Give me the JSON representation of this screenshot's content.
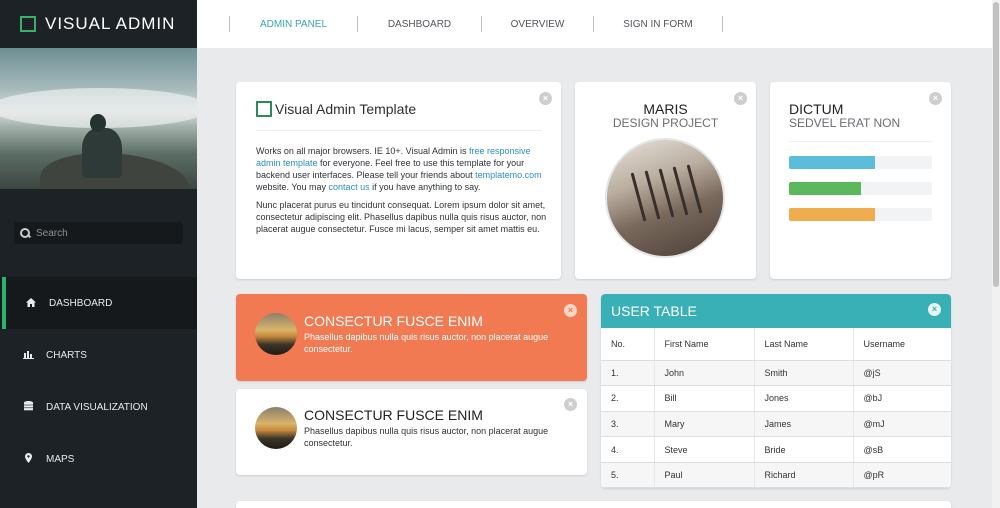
{
  "brand": {
    "title": "VISUAL ADMIN"
  },
  "search": {
    "placeholder": "Search"
  },
  "sidebar": {
    "items": [
      {
        "label": "DASHBOARD",
        "icon": "home-icon",
        "active": true
      },
      {
        "label": "CHARTS",
        "icon": "bar-chart-icon"
      },
      {
        "label": "DATA VISUALIZATION",
        "icon": "database-icon"
      },
      {
        "label": "MAPS",
        "icon": "map-marker-icon"
      }
    ]
  },
  "topnav": {
    "items": [
      {
        "label": "ADMIN PANEL",
        "active": true
      },
      {
        "label": "DASHBOARD"
      },
      {
        "label": "OVERVIEW"
      },
      {
        "label": "SIGN IN FORM"
      }
    ]
  },
  "intro": {
    "title": "Visual Admin Template",
    "p1_a": "Works on all major browsers. IE 10+. Visual Admin is ",
    "p1_link1": "free responsive admin template",
    "p1_b": " for everyone. Feel free to use this template for your backend user interfaces. Please tell your friends about ",
    "p1_link2": "templatemo.com",
    "p1_c": " website. You may ",
    "p1_link3": "contact us",
    "p1_d": " if you have anything to say.",
    "p2": "Nunc placerat purus eu tincidunt consequat. Lorem ipsum dolor sit amet, consectetur adipiscing elit. Phasellus dapibus nulla quis risus auctor, non placerat augue consectetur. Fusce mi lacus, semper sit amet mattis eu."
  },
  "profile": {
    "name": "MARIS",
    "subtitle": "DESIGN PROJECT"
  },
  "progress": {
    "title": "DICTUM",
    "subtitle": "SEDVEL ERAT NON",
    "bars": [
      {
        "value": 0.6,
        "color": "#5bbcdc"
      },
      {
        "value": 0.5,
        "color": "#5bb85d"
      },
      {
        "value": 0.6,
        "color": "#f0ad4e"
      }
    ]
  },
  "alerts": [
    {
      "title": "CONSECTUR FUSCE ENIM",
      "text": "Phasellus dapibus nulla quis risus auctor, non placerat augue consectetur."
    },
    {
      "title": "CONSECTUR FUSCE ENIM",
      "text": "Phasellus dapibus nulla quis risus auctor, non placerat augue consectetur."
    }
  ],
  "user_table": {
    "title": "USER TABLE",
    "columns": [
      "No.",
      "First Name",
      "Last Name",
      "Username"
    ],
    "rows": [
      [
        "1.",
        "John",
        "Smith",
        "@jS"
      ],
      [
        "2.",
        "Bill",
        "Jones",
        "@bJ"
      ],
      [
        "3.",
        "Mary",
        "James",
        "@mJ"
      ],
      [
        "4.",
        "Steve",
        "Bride",
        "@sB"
      ],
      [
        "5.",
        "Paul",
        "Richard",
        "@pR"
      ]
    ]
  },
  "colors": {
    "accent_green": "#2cb36b",
    "accent_teal": "#39b0b6",
    "alert_orange": "#f27a53"
  }
}
